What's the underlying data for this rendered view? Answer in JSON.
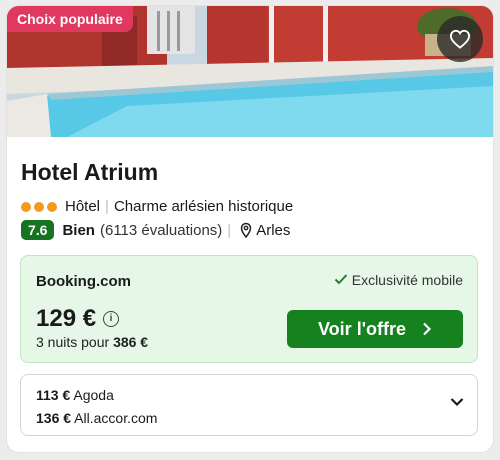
{
  "badge": "Choix populaire",
  "hotel": {
    "name": "Hotel Atrium",
    "stars": 3,
    "type": "Hôtel",
    "tagline": "Charme arlésien historique",
    "score": "7.6",
    "rating_word": "Bien",
    "reviews": "(6113 évaluations)",
    "location": "Arles"
  },
  "deal": {
    "provider": "Booking.com",
    "exclusive": "Exclusivité mobile",
    "price": "129 €",
    "info_glyph": "i",
    "nights_prefix": "3 nuits pour",
    "nights_total": "386 €",
    "cta_label": "Voir l'offre"
  },
  "other_offers": [
    {
      "price": "113 €",
      "provider": "Agoda"
    },
    {
      "price": "136 €",
      "provider": "All.accor.com"
    }
  ],
  "colors": {
    "badge": "#e0385e",
    "score": "#16731f",
    "cta": "#16821f",
    "deal_bg": "#e6f7e8",
    "star_dot": "#f39a1e"
  },
  "icons": [
    "heart-icon",
    "map-pin-icon",
    "check-icon",
    "info-icon",
    "chevron-right-icon",
    "chevron-down-icon"
  ]
}
